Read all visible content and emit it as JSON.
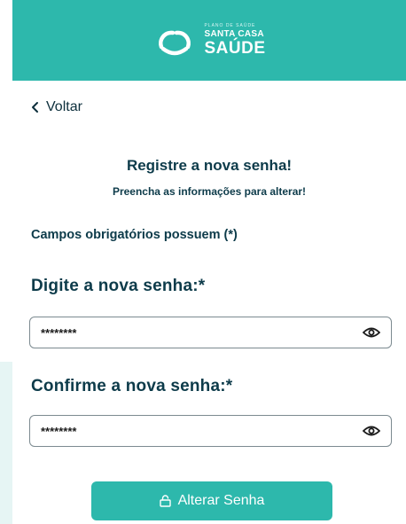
{
  "brand": {
    "tagline": "PLANO DE SAÚDE",
    "name_top": "SANTA CASA",
    "name_bottom": "SAÚDE"
  },
  "nav": {
    "back_label": "Voltar",
    "back_icon": "chevron-left-icon"
  },
  "form": {
    "title": "Registre a nova senha!",
    "subtitle": "Preencha as informações para alterar!",
    "required_note": "Campos obrigatórios possuem (*)",
    "new_password": {
      "label": "Digite a nova senha:*",
      "value": "********",
      "icon": "eye-icon"
    },
    "confirm_password": {
      "label": "Confirme a nova senha:*",
      "value": "********",
      "icon": "eye-icon"
    },
    "submit_label": "Alterar Senha",
    "submit_icon": "lock-icon"
  },
  "colors": {
    "primary": "#2db8ac",
    "text": "#0d3b4a"
  }
}
